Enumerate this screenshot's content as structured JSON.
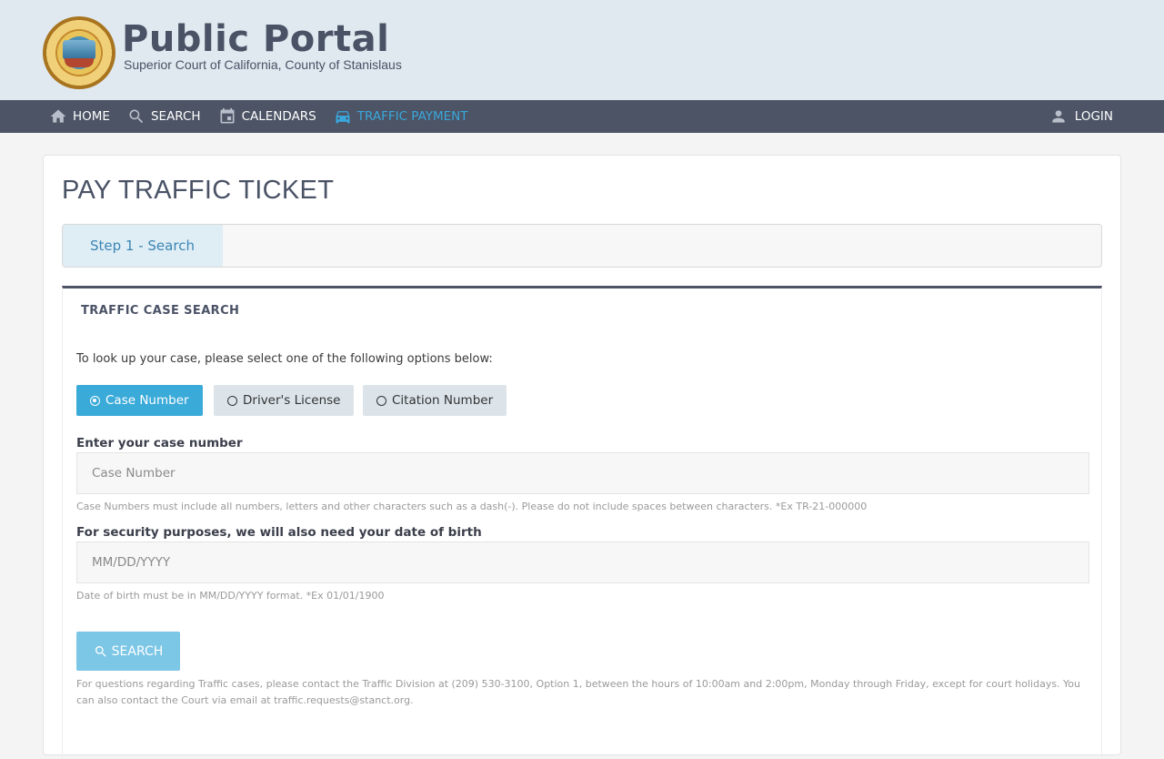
{
  "brand": {
    "title": "Public Portal",
    "subtitle": "Superior Court of California, County of Stanislaus"
  },
  "nav": {
    "items": [
      {
        "label": "HOME",
        "icon": "home-icon"
      },
      {
        "label": "SEARCH",
        "icon": "search-icon"
      },
      {
        "label": "CALENDARS",
        "icon": "calendar-icon"
      },
      {
        "label": "TRAFFIC PAYMENT",
        "icon": "car-icon",
        "active": true
      }
    ],
    "login_label": "LOGIN"
  },
  "page": {
    "title": "PAY TRAFFIC TICKET",
    "step_label": "Step 1 - Search"
  },
  "panel": {
    "title": "TRAFFIC CASE SEARCH",
    "intro": "To look up your case, please select one of the following options below:",
    "options": [
      {
        "label": "Case Number",
        "selected": true
      },
      {
        "label": "Driver's License",
        "selected": false
      },
      {
        "label": "Citation Number",
        "selected": false
      }
    ],
    "case_label": "Enter your case number",
    "case_placeholder": "Case Number",
    "case_help": "Case Numbers must include all numbers, letters and other characters such as a dash(-). Please do not include spaces between characters. *Ex TR-21-000000",
    "dob_label": "For security purposes, we will also need your date of birth",
    "dob_placeholder": "MM/DD/YYYY",
    "dob_help": "Date of birth must be in MM/DD/YYYY format. *Ex 01/01/1900",
    "search_label": "SEARCH",
    "footer_note": "For questions regarding Traffic cases, please contact the Traffic Division at (209) 530-3100, Option 1, between the hours of 10:00am and 2:00pm, Monday through Friday, except for court holidays. You can also contact the Court via email at traffic.requests@stanct.org."
  },
  "colors": {
    "accent": "#3aaad9",
    "nav_bg": "#4c5465",
    "header_bg": "#dfe9ef"
  }
}
